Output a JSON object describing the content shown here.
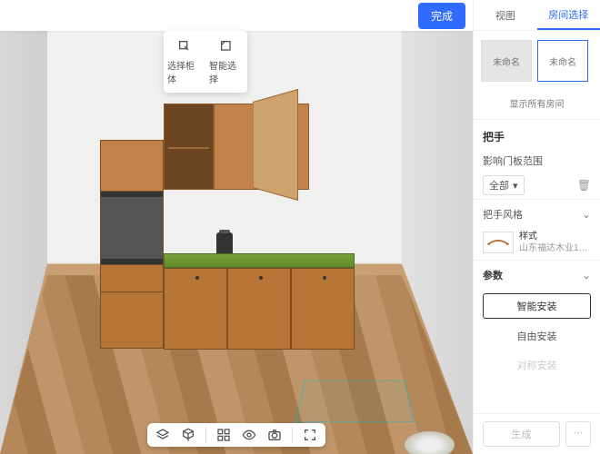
{
  "topbar": {
    "done": "完成"
  },
  "popover": {
    "select_body": "选择柜体",
    "smart_select": "智能选择"
  },
  "bottom_toolbar": {
    "icons": [
      "layers",
      "cube",
      "sep",
      "grid",
      "eye",
      "camera",
      "expand"
    ]
  },
  "tabs": {
    "view": "视图",
    "room_select": "房间选择"
  },
  "rooms": {
    "item1": "未命名",
    "item2": "未命名",
    "show_all": "显示所有房间"
  },
  "handle": {
    "section": "把手",
    "scope_label": "影响门板范围",
    "scope_value": "全部",
    "style_label": "把手风格",
    "style_name": "样式",
    "style_sub": "山东福达木业1-拉手-…"
  },
  "params": {
    "section": "参数",
    "smart_install": "智能安装",
    "free_install": "自由安装",
    "sym_install": "对称安装"
  },
  "footer": {
    "generate": "生成"
  }
}
